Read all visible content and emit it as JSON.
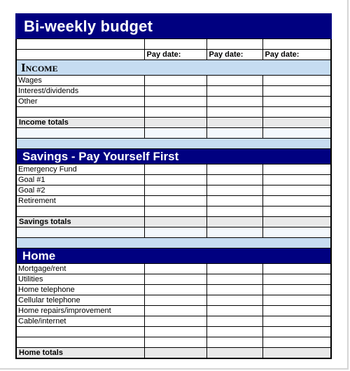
{
  "document": {
    "title": "Bi-weekly  budget"
  },
  "columns": {
    "label_header": "",
    "pay_headers": [
      "Pay date:",
      "Pay date:",
      "Pay date:"
    ]
  },
  "sections": [
    {
      "id": "income",
      "heading": "Income",
      "style": "light",
      "rows": [
        "Wages",
        "Interest/dividends",
        "Other",
        ""
      ],
      "total_label": "Income totals",
      "trailing_blank_rows": 1
    },
    {
      "id": "savings",
      "heading": "Savings - Pay Yourself First",
      "style": "navy",
      "rows": [
        "Emergency Fund",
        "Goal #1",
        "Goal #2",
        "Retirement",
        ""
      ],
      "total_label": "Savings totals",
      "trailing_blank_rows": 1
    },
    {
      "id": "home",
      "heading": "Home",
      "style": "navy",
      "rows": [
        "Mortgage/rent",
        "Utilities",
        "Home telephone",
        "Cellular telephone",
        "Home repairs/improvement",
        "Cable/internet",
        "",
        ""
      ],
      "total_label": "Home totals",
      "trailing_blank_rows": 0
    }
  ],
  "colors": {
    "navy": "#000080",
    "light_blue": "#c6dcf1",
    "total_gray": "#e9e9e9",
    "grid": "#000000",
    "page_border": "#d6d6d6"
  }
}
